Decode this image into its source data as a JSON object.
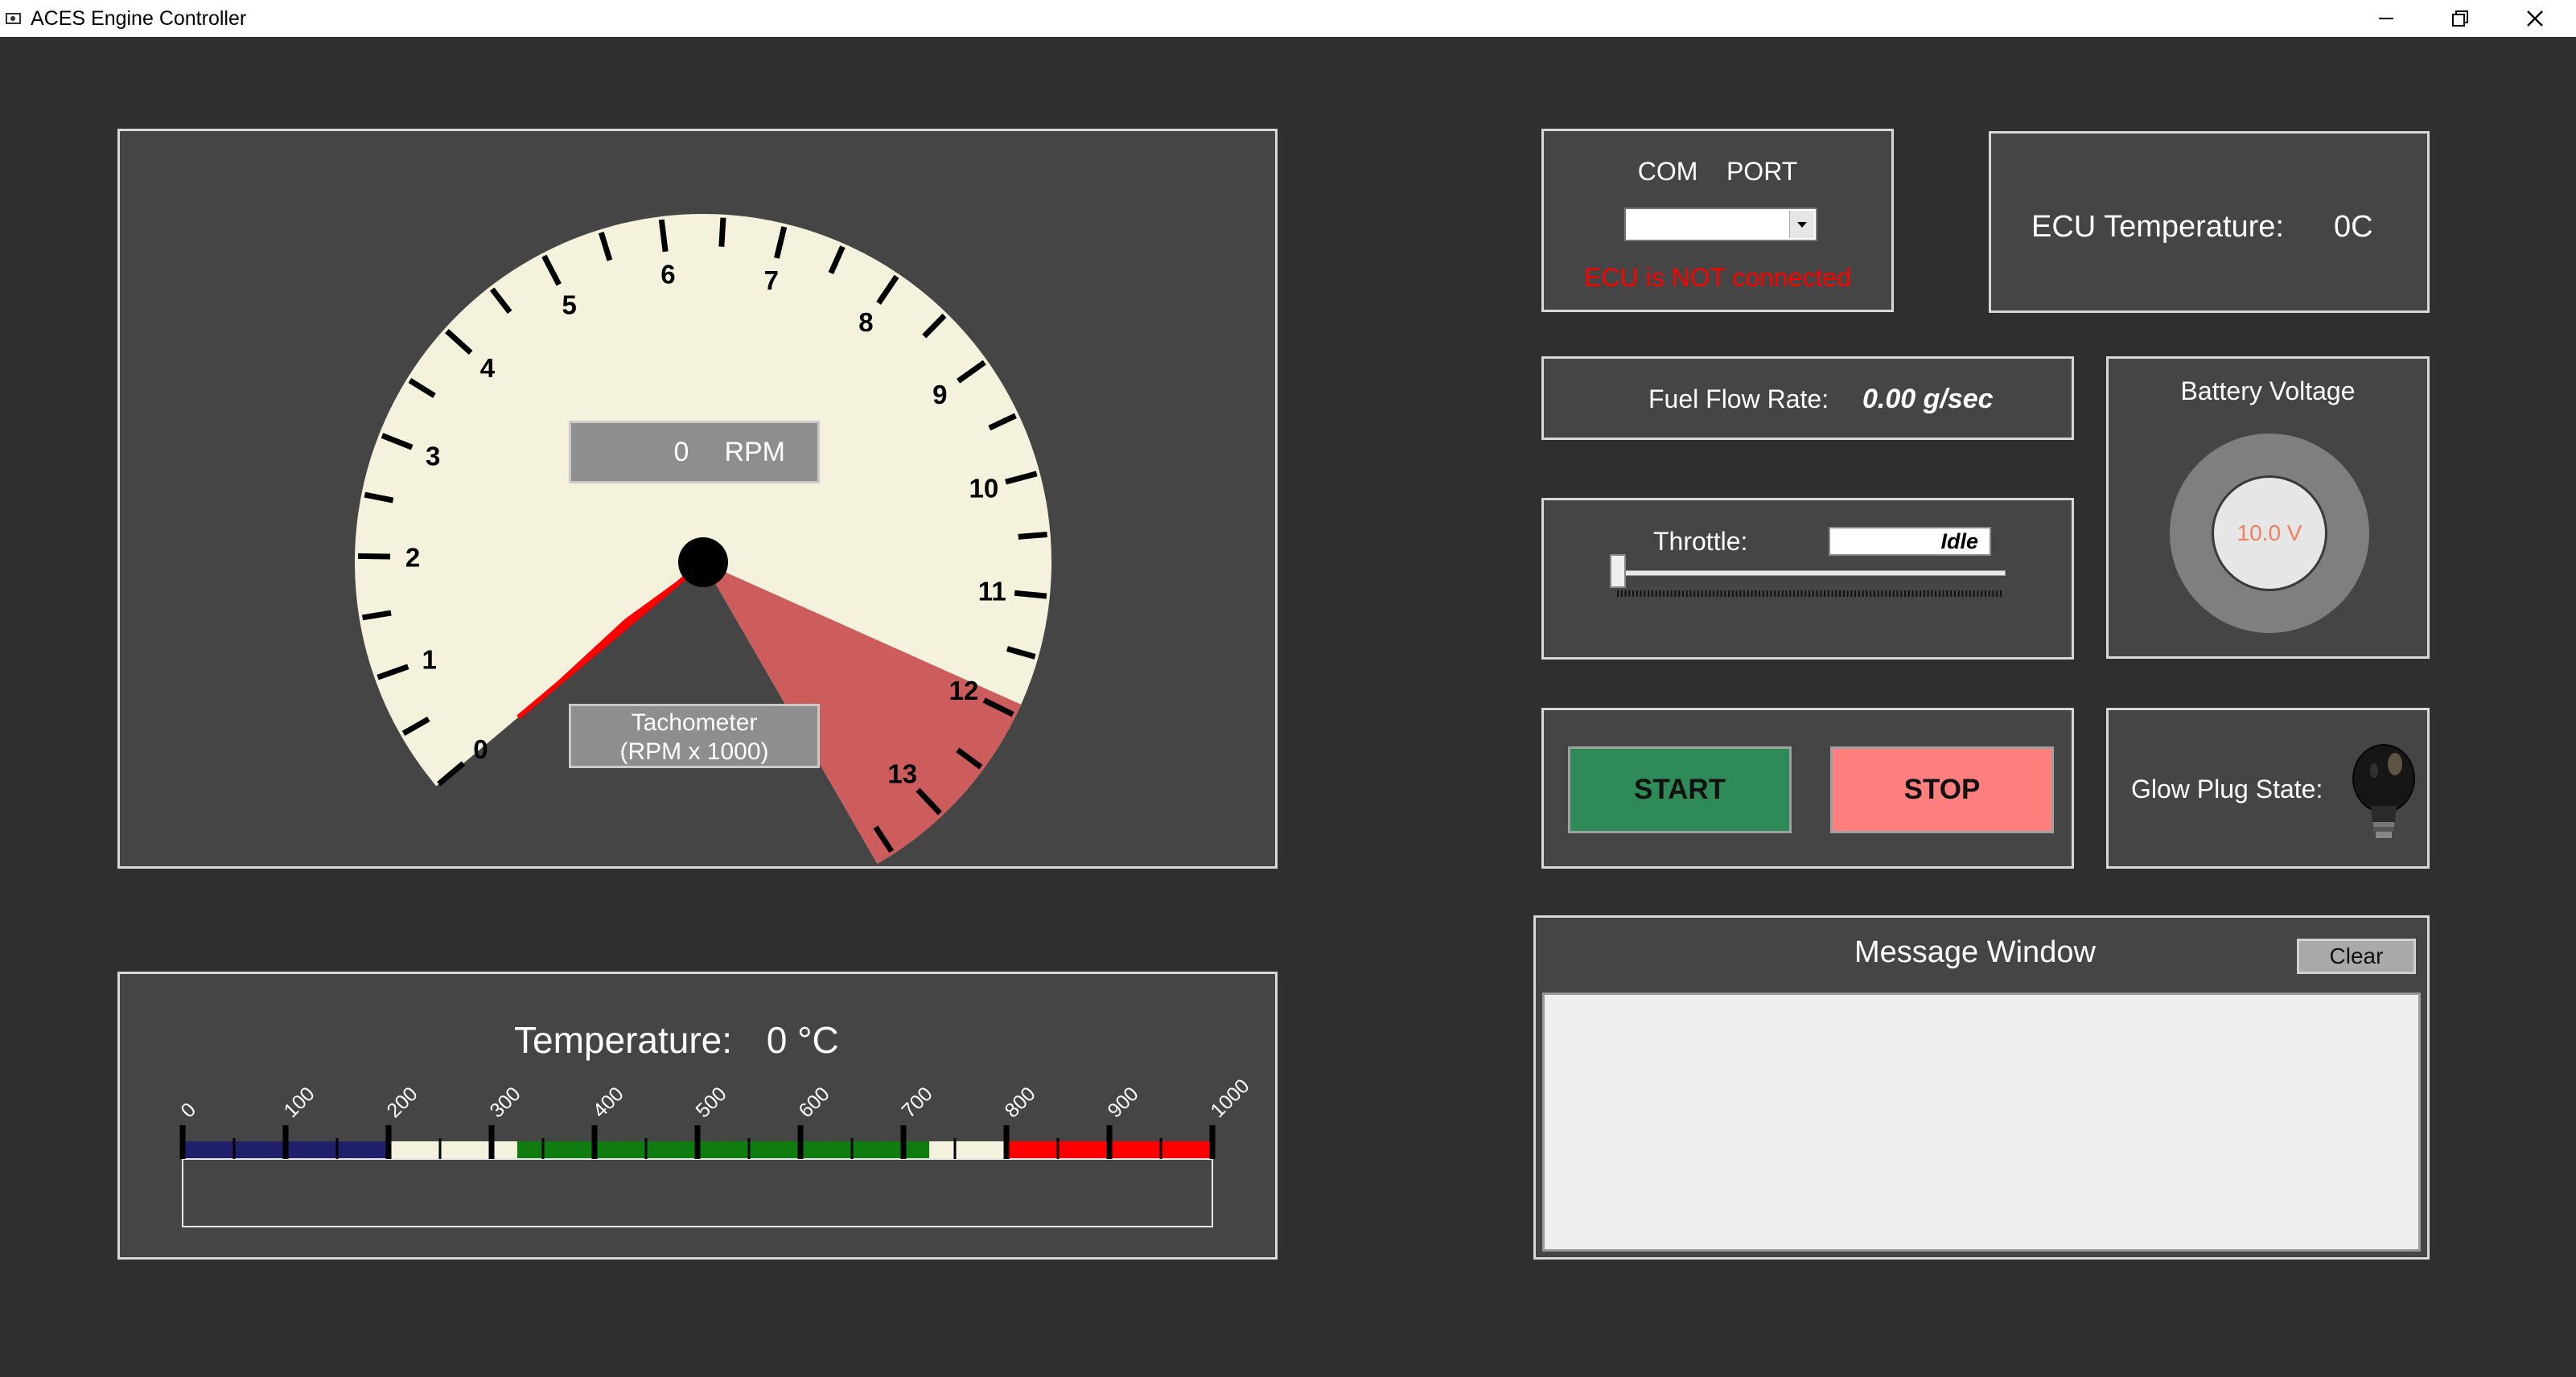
{
  "window": {
    "title": "ACES Engine Controller",
    "minimize_icon": "minimize-icon",
    "maximize_icon": "restore-icon",
    "close_icon": "close-icon"
  },
  "tachometer": {
    "rpm_value": "0",
    "rpm_unit": "RPM",
    "caption_line1": "Tachometer",
    "caption_line2": "(RPM x 1000)",
    "scale_labels": [
      "0",
      "1",
      "2",
      "3",
      "4",
      "5",
      "6",
      "7",
      "8",
      "9",
      "10",
      "11",
      "12",
      "13"
    ],
    "redline_start": 11.9,
    "scale_max": 13.65,
    "needle_value": 0,
    "colors": {
      "face": "#f4f2dc",
      "redzone": "#cd5c5c",
      "needle": "#ff0000"
    }
  },
  "temperature": {
    "label": "Temperature:",
    "value": "0 °C",
    "scale_labels": [
      "0",
      "100",
      "200",
      "300",
      "400",
      "500",
      "600",
      "700",
      "800",
      "900",
      "1000"
    ],
    "color_bands": [
      {
        "from": 0,
        "to": 200,
        "color": "#1f1f6b"
      },
      {
        "from": 200,
        "to": 325,
        "color": "#f4f2dc"
      },
      {
        "from": 325,
        "to": 725,
        "color": "#0f7c0f"
      },
      {
        "from": 725,
        "to": 800,
        "color": "#f4f2dc"
      },
      {
        "from": 800,
        "to": 1000,
        "color": "#ff0000"
      }
    ],
    "fill_value": 0
  },
  "com_port": {
    "label": "COM    PORT",
    "selected": "",
    "status": "ECU is NOT connected",
    "status_color": "#ff0000"
  },
  "ecu": {
    "label": "ECU Temperature:",
    "value": "0C"
  },
  "fuel": {
    "label": "Fuel Flow Rate:",
    "value": "0.00 g/sec"
  },
  "battery": {
    "label": "Battery Voltage",
    "value": "10.0 V",
    "value_color": "#f08060"
  },
  "throttle": {
    "label": "Throttle:",
    "value": "Idle",
    "level": 0
  },
  "controls": {
    "start_label": "START",
    "start_color": "#2e8b57",
    "stop_label": "STOP",
    "stop_color": "#ff7f7f"
  },
  "glow": {
    "label": "Glow Plug State:",
    "icon": "light-bulb-icon"
  },
  "messages": {
    "title": "Message Window",
    "clear_label": "Clear",
    "items": []
  }
}
